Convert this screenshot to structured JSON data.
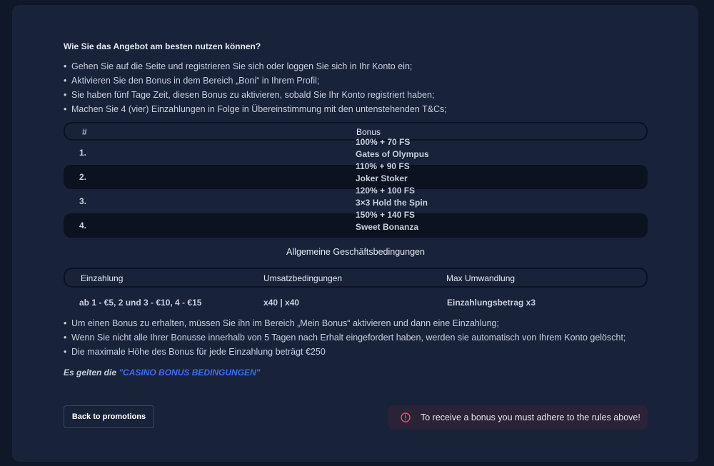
{
  "intro": {
    "heading": "Wie Sie das Angebot am besten nutzen können?",
    "steps": [
      "Gehen Sie auf die Seite und registrieren Sie sich oder loggen Sie sich in Ihr Konto ein;",
      "Aktivieren Sie den Bonus in dem Bereich „Boni“ in Ihrem Profil;",
      "Sie haben fünf Tage Zeit, diesen Bonus zu aktivieren, sobald Sie Ihr Konto registriert haben;",
      "Machen Sie 4 (vier) Einzahlungen in Folge in Übereinstimmung mit den untenstehenden T&Cs;"
    ]
  },
  "bonus_table": {
    "headers": {
      "number": "#",
      "bonus": "Bonus"
    },
    "rows": [
      {
        "number": "1.",
        "offer": "100% + 70 FS",
        "game": "Gates of Olympus"
      },
      {
        "number": "2.",
        "offer": "110% + 90 FS",
        "game": "Joker Stoker"
      },
      {
        "number": "3.",
        "offer": "120% + 100 FS",
        "game": "3×3 Hold the Spin"
      },
      {
        "number": "4.",
        "offer": "150% + 140 FS",
        "game": "Sweet Bonanza"
      }
    ]
  },
  "terms": {
    "title": "Allgemeine Geschäftsbedingungen",
    "headers": {
      "deposit": "Einzahlung",
      "wagering": "Umsatzbedingungen",
      "max": "Max Umwandlung"
    },
    "row": {
      "deposit": "ab 1 - €5, 2 und 3 - €10, 4 - €15",
      "wagering": "x40 | x40",
      "max": "Einzahlungsbetrag x3"
    }
  },
  "rules": [
    "Um einen Bonus zu erhalten, müssen Sie ihn im Bereich „Mein Bonus“ aktivieren und dann eine Einzahlung;",
    "Wenn Sie nicht alle Ihrer Bonusse innerhalb von 5 Tagen nach Erhalt eingefordert haben, werden sie automatisch von Ihrem Konto gelöscht;",
    "Die maximale Höhe des Bonus für jede Einzahlung beträgt €250"
  ],
  "note": {
    "prefix": "Es gelten die ",
    "link": "\"CASINO BONUS BEDINGUNGEN\""
  },
  "actions": {
    "back_label": "Back to promotions",
    "alert_text": "To receive a bonus you must adhere to the rules above!"
  },
  "colors": {
    "background": "#0f1828",
    "card": "#18233a",
    "link": "#3b6cf5",
    "alert_icon": "#e0506e"
  }
}
